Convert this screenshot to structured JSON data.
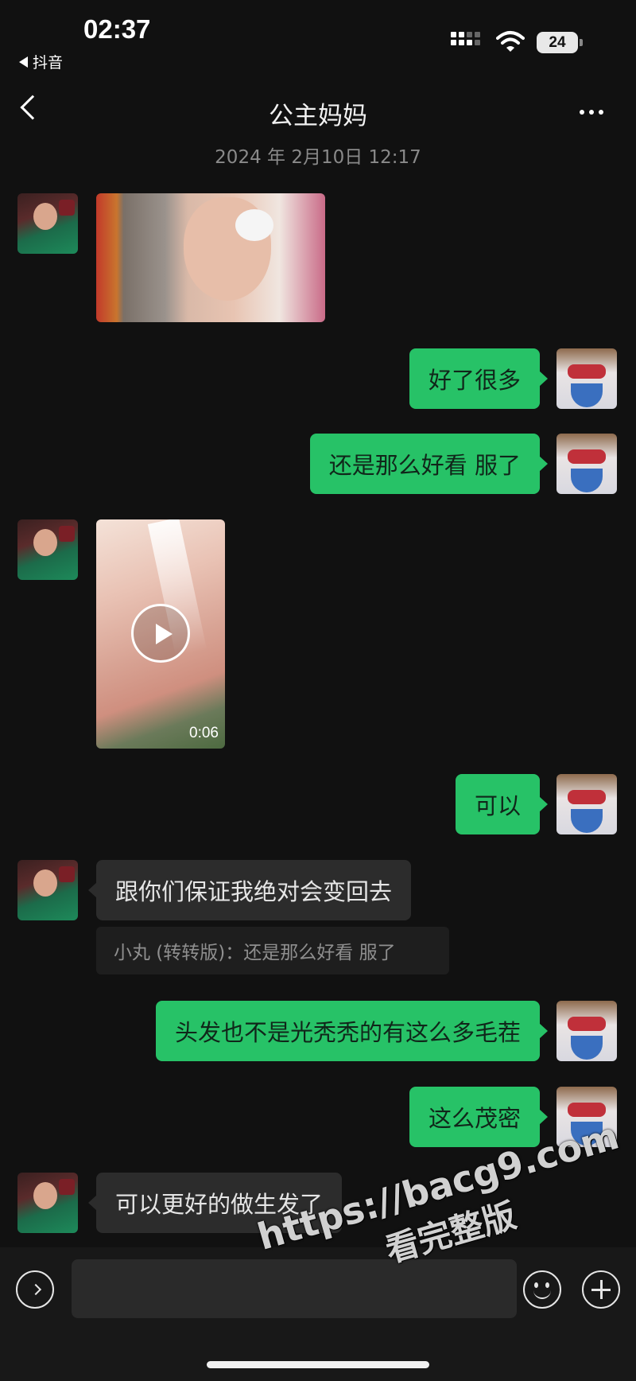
{
  "status_bar": {
    "time": "02:37",
    "back_app": "抖音",
    "battery": "24"
  },
  "header": {
    "title": "公主妈妈"
  },
  "timestamp": "2024 年 2月10日 12:17",
  "messages": [
    {
      "from": "other",
      "type": "image"
    },
    {
      "from": "me",
      "text": "好了很多"
    },
    {
      "from": "me",
      "text": "还是那么好看 服了"
    },
    {
      "from": "other",
      "type": "video",
      "duration": "0:06"
    },
    {
      "from": "me",
      "text": "可以"
    },
    {
      "from": "other",
      "text": "跟你们保证我绝对会变回去",
      "quote": "小丸 (转转版)：还是那么好看 服了"
    },
    {
      "from": "me",
      "text": "头发也不是光秃秃的有这么多毛茬"
    },
    {
      "from": "me",
      "text": "这么茂密"
    },
    {
      "from": "other",
      "text": "可以更好的做生发了"
    }
  ],
  "watermark": {
    "url": "https://bacg9.com",
    "text": "看完整版"
  },
  "colors": {
    "background": "#111111",
    "outgoing_bubble": "#27c267",
    "incoming_bubble": "#2c2c2c"
  },
  "icons": [
    "signal-icon",
    "wifi-icon",
    "back-icon",
    "more-icon",
    "voice-icon",
    "emoji-icon",
    "plus-icon",
    "play-icon"
  ]
}
